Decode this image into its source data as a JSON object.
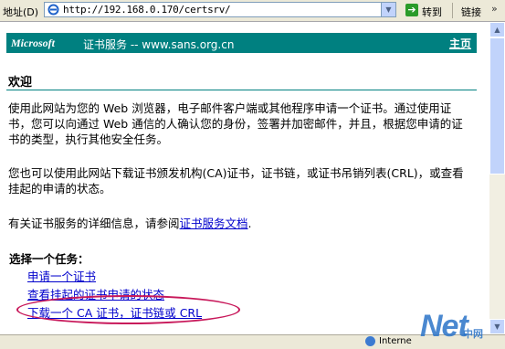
{
  "address_bar": {
    "label": "地址(D)",
    "url": "http://192.168.0.170/certsrv/",
    "go_label": "转到",
    "links_label": "链接"
  },
  "banner": {
    "logo_text": "Microsoft",
    "subtitle": "证书服务  --  www.sans.org.cn",
    "home_link": "主页"
  },
  "page": {
    "title": "欢迎",
    "para1": "使用此网站为您的 Web 浏览器，电子邮件客户端或其他程序申请一个证书。通过使用证书，您可以向通过 Web 通信的人确认您的身份，签署并加密邮件，并且，根据您申请的证书的类型，执行其他安全任务。",
    "para2": "您也可以使用此网站下载证书颁发机构(CA)证书，证书链，或证书吊销列表(CRL)，或查看挂起的申请的状态。",
    "para3_prefix": "有关证书服务的详细信息，请参阅",
    "para3_link": "证书服务文档",
    "para3_suffix": ".",
    "task_title": "选择一个任务：",
    "tasks": [
      "申请一个证书",
      "查看挂起的证书申请的状态",
      "下载一个 CA 证书，证书链或 CRL"
    ]
  },
  "status_bar": {
    "zone": "Interne"
  },
  "watermark": {
    "logo": "Net",
    "sub": "中网"
  },
  "colors": {
    "banner": "#008080",
    "link": "#0000cc",
    "highlight_ring": "#c8185a"
  }
}
